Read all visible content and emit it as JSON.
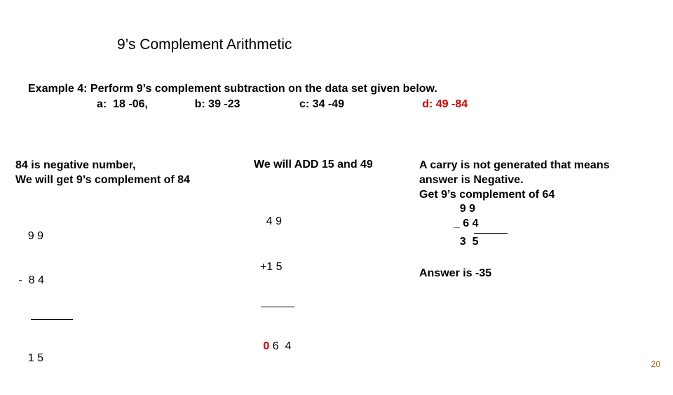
{
  "title": "9’s Complement Arithmetic",
  "example_line": "Example 4: Perform  9’s complement subtraction on the data set given below.",
  "items_a": "a:  18 -06,",
  "items_b": "b: 39 -23",
  "items_c": "c: 34 -49",
  "items_d": "d: 49 -84",
  "col1": {
    "l1": "84 is negative number,",
    "l2": "We will get 9’s complement of  84",
    "c1": "    9 9",
    "c2": " -  8 4",
    "c3": "    1 5"
  },
  "col2": {
    "head": "We will ADD 15 and 49",
    "c1": "    4 9",
    "c2": "  +1 5",
    "carry0": "0",
    "rest": " 6  4"
  },
  "col3": {
    "p1a": "A carry is ",
    "p1b": "not",
    "p1c": " generated that means",
    "p2": "answer is Negative.",
    "p3": "Get 9’s complement of 64",
    "n1": "             9 9",
    "n2": "           _ 6 4",
    "res": "             3  5",
    "ans": "Answer is -35"
  },
  "page": "20"
}
